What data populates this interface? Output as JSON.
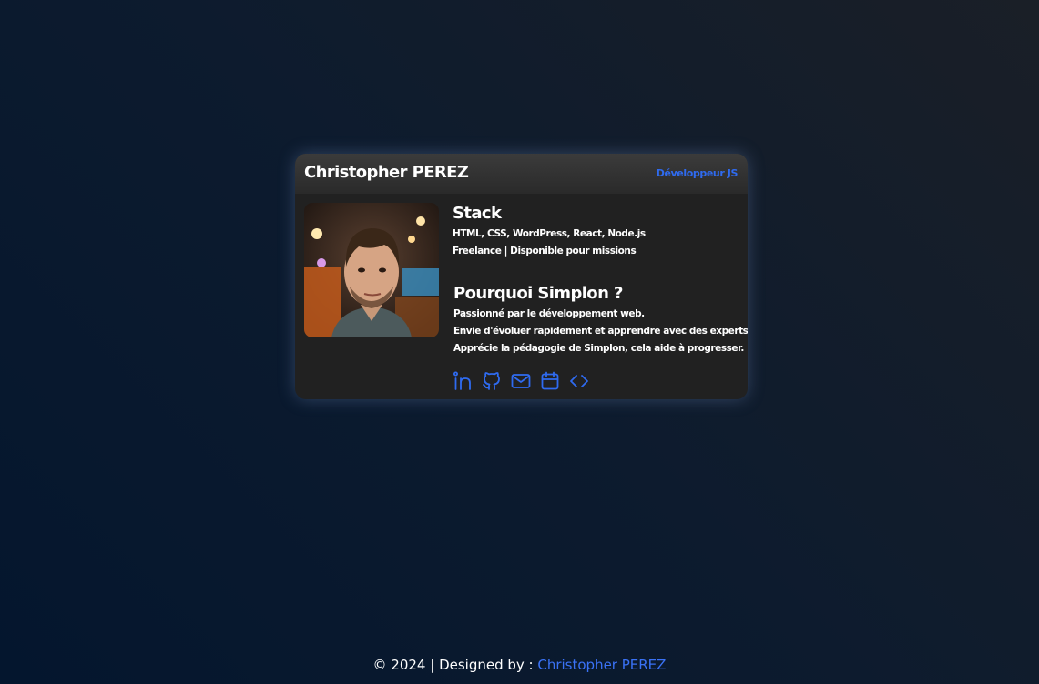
{
  "card": {
    "name": "Christopher PEREZ",
    "role": "Développeur JS",
    "stack": {
      "title": "Stack",
      "technologies": "HTML, CSS, WordPress, React, Node.js",
      "availability": "Freelance | Disponible pour missions"
    },
    "why": {
      "title": "Pourquoi Simplon ?",
      "lines": [
        "Passionné par le développement web.",
        "Envie d'évoluer rapidement et apprendre avec des experts.",
        "Apprécie la pédagogie de Simplon, cela aide à progresser."
      ]
    },
    "icons": [
      "linkedin-icon",
      "github-icon",
      "mail-icon",
      "calendar-icon",
      "code-icon"
    ]
  },
  "footer": {
    "prefix": "© 2024 | Designed by : ",
    "author": "Christopher PEREZ"
  },
  "colors": {
    "accent": "#2f6bf0",
    "card_bg": "#212121",
    "page_bg": "#0d1b2e"
  }
}
